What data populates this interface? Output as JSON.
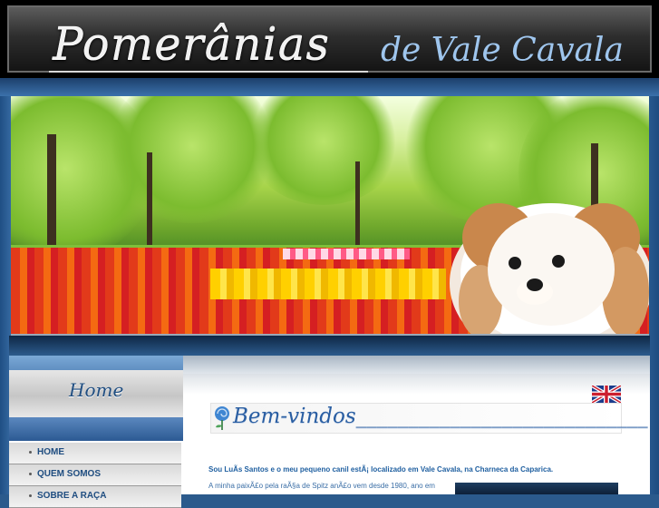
{
  "header": {
    "title": "Pomerânias",
    "subtitle": "de Vale Cavala"
  },
  "sidebar": {
    "heading": "Home",
    "menu": [
      {
        "label": "HOME"
      },
      {
        "label": "QUEM SOMOS"
      },
      {
        "label": "SOBRE A RAÇA"
      }
    ]
  },
  "content": {
    "welcome": "Bem-vindos____________________________",
    "intro": "Sou LuÃs Santos e o meu pequeno canil estÃ¡ localizado em Vale Cavala, na Charneca da Caparica.",
    "body_line": "A minha paixÃ£o pela raÃ§a de Spitz anÃ£o vem desde 1980, ano em"
  },
  "colors": {
    "accent_blue": "#2a5ea2",
    "header_bg": "#000000",
    "menu_text": "#1f4d80"
  },
  "icons": {
    "language": "uk-flag-icon",
    "welcome": "blue-rose-icon",
    "menu_bullet": "bullet-icon"
  }
}
